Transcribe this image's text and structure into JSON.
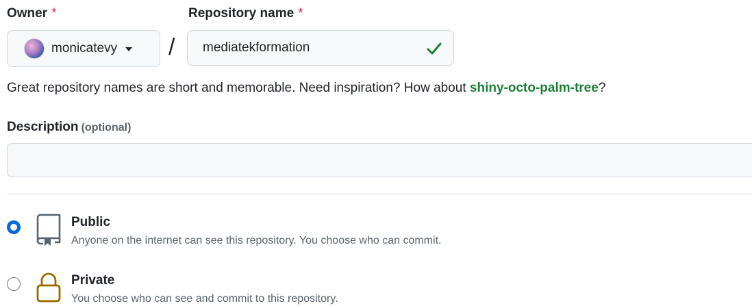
{
  "owner": {
    "label": "Owner",
    "required_mark": "*",
    "name": "monicatevy"
  },
  "repo": {
    "label": "Repository name",
    "required_mark": "*",
    "value": "mediatekformation",
    "separator": "/",
    "valid_icon": "check-icon"
  },
  "hint": {
    "prefix": "Great repository names are short and memorable. Need inspiration? How about ",
    "suggestion": "shiny-octo-palm-tree",
    "suffix": "?"
  },
  "description": {
    "label": "Description",
    "optional_note": "(optional)",
    "value": ""
  },
  "visibility": {
    "public": {
      "title": "Public",
      "description": "Anyone on the internet can see this repository. You choose who can commit.",
      "selected": true,
      "icon": "repo-icon"
    },
    "private": {
      "title": "Private",
      "description": "You choose who can see and commit to this repository.",
      "selected": false,
      "icon": "lock-icon"
    }
  },
  "colors": {
    "required": "#cf222e",
    "suggestion": "#1a7f37",
    "radio_selected": "#0969da",
    "check": "#1a7f37",
    "lock": "#9a6700"
  }
}
